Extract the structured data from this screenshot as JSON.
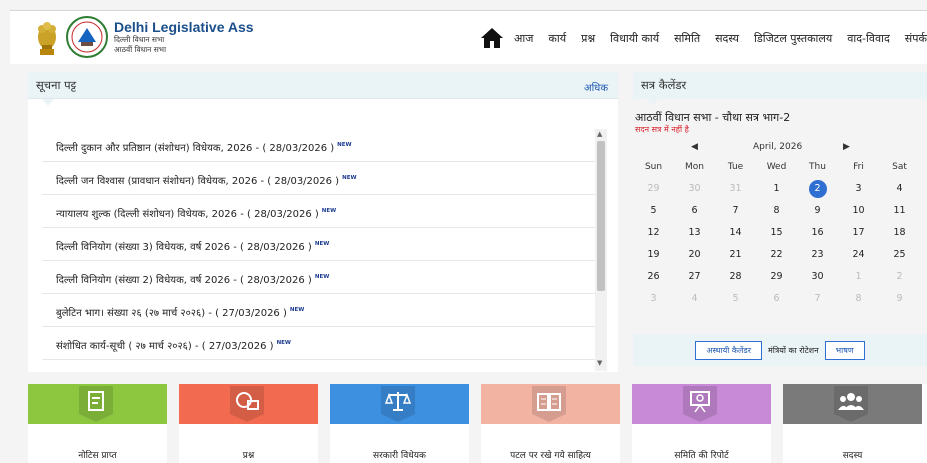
{
  "header": {
    "title": "Delhi Legislative Assem",
    "subtitle1": "दिल्ली विधान सभा",
    "subtitle2": "आठवीं विधान सभा",
    "nav": [
      "आज",
      "कार्य",
      "प्रश्न",
      "विधायी कार्य",
      "समिति",
      "सदस्य",
      "डिजिटल पुस्तकालय",
      "वाद-विवाद",
      "संपर्क"
    ]
  },
  "notice": {
    "title": "सूचना पट्ट",
    "more": "अधिक",
    "new_label": "NEW",
    "items": [
      "दिल्ली दुकान और प्रतिष्ठान (संशोधन) विधेयक, 2026 - ( 28/03/2026 )",
      "दिल्ली जन विश्वास (प्रावधान संशोधन) विधेयक, 2026 - ( 28/03/2026 )",
      "न्यायालय शुल्क (दिल्ली संशोधन) विधेयक, 2026 - ( 28/03/2026 )",
      "दिल्ली विनियोग (संख्या 3) विधेयक, वर्ष 2026 - ( 28/03/2026 )",
      "दिल्ली विनियोग (संख्या 2) विधेयक, वर्ष 2026 - ( 28/03/2026 )",
      "बुलेटिन भाग। संख्या २६ (२७ मार्च २०२६) - ( 27/03/2026 )",
      "संशोधित कार्य-सूची ( २७ मार्च २०२६) - ( 27/03/2026 )"
    ]
  },
  "calendar": {
    "title": "सत्र कैलेंडर",
    "session": "आठवीं विधान सभा - चौथा सत्र भाग-2",
    "note": "सदन सत्र में नहीं है",
    "month": "April, 2026",
    "prev": "◀",
    "next": "▶",
    "dow": [
      "Sun",
      "Mon",
      "Tue",
      "Wed",
      "Thu",
      "Fri",
      "Sat"
    ],
    "weeks": [
      [
        "29",
        "30",
        "31",
        "1",
        "2",
        "3",
        "4"
      ],
      [
        "5",
        "6",
        "7",
        "8",
        "9",
        "10",
        "11"
      ],
      [
        "12",
        "13",
        "14",
        "15",
        "16",
        "17",
        "18"
      ],
      [
        "19",
        "20",
        "21",
        "22",
        "23",
        "24",
        "25"
      ],
      [
        "26",
        "27",
        "28",
        "29",
        "30",
        "1",
        "2"
      ],
      [
        "3",
        "4",
        "5",
        "6",
        "7",
        "8",
        "9"
      ]
    ],
    "today": "2",
    "buttons": {
      "provisional": "अस्थायी कैलेंडर",
      "rotation": "मंत्रियों का रोटेशन",
      "speech": "भाषण"
    }
  },
  "tiles": [
    {
      "label": "नोटिस प्राप्त",
      "icon": "document-edit-icon",
      "color": "#8dc63f"
    },
    {
      "label": "प्रश्न",
      "icon": "question-chat-icon",
      "color": "#f26a4f"
    },
    {
      "label": "सरकारी विधेयक",
      "icon": "scales-icon",
      "color": "#3d8fe0"
    },
    {
      "label": "पटल पर रखे गये साहित्य",
      "icon": "open-book-icon",
      "color": "#f3b3a3"
    },
    {
      "label": "समिति की रिपोर्ट",
      "icon": "presentation-icon",
      "color": "#c889d6"
    },
    {
      "label": "सदस्य",
      "icon": "group-icon",
      "color": "#7a7a7a"
    }
  ]
}
